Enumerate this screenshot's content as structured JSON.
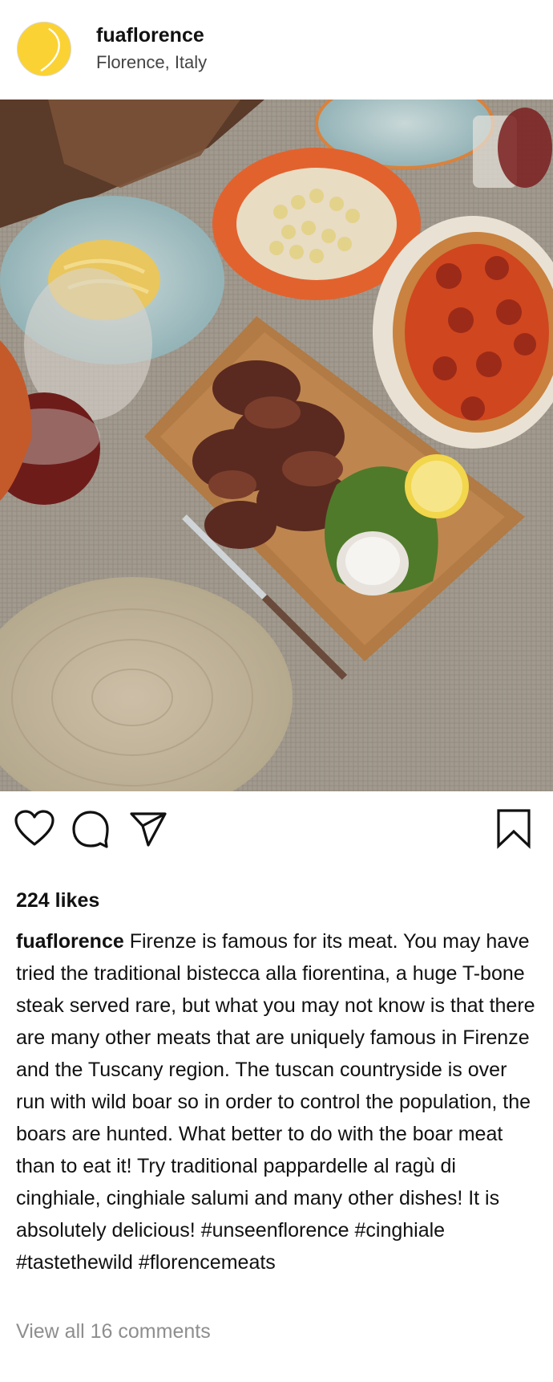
{
  "header": {
    "username": "fuaflorence",
    "location": "Florence, Italy",
    "avatar_icon": "yellow-ball-avatar-icon"
  },
  "post": {
    "image_icon": "food-photo",
    "likes": "224 likes",
    "caption_user": "fuaflorence",
    "caption_text": "Firenze is famous for its meat. You may have tried the traditional bistecca alla fiorentina, a huge T-bone steak served rare, but what you may not know is that there are many other meats that are uniquely famous in Firenze and the Tuscany region. The tuscan countryside is over run with wild boar so in order to control the population, the boars are hunted. What better to do with the boar meat than to eat it! Try traditional pappardelle al ragù di cinghiale, cinghiale salumi and many other dishes! It is absolutely delicious! #unseenflorence #cinghiale #tastethewild #florencemeats",
    "view_comments": "View all 16 comments"
  },
  "actions": {
    "like": "heart-icon",
    "comment": "comment-bubble-icon",
    "share": "paper-plane-icon",
    "save": "bookmark-icon"
  },
  "colors": {
    "avatar_yellow": "#fbd233",
    "muted_text": "#8e8e8e"
  }
}
